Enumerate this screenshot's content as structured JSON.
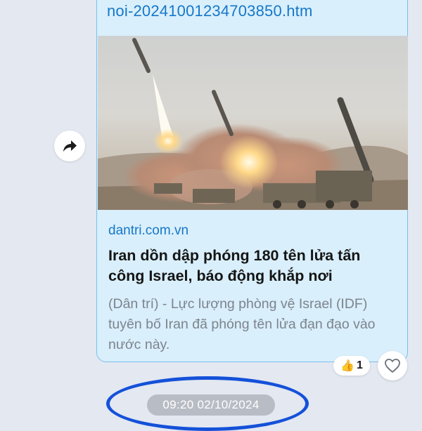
{
  "message": {
    "link_url_fragment": "noi-20241001234703850.htm",
    "preview": {
      "image_name": "missile-launch-photo",
      "domain": "dantri.com.vn",
      "title": "Iran dồn dập phóng 180 tên lửa tấn công Israel, báo động khắp nơi",
      "description": "(Dân trí) - Lực lượng phòng vệ Israel (IDF) tuyên bố Iran đã phóng tên lửa đạn đạo vào nước này."
    },
    "reaction": {
      "emoji": "👍",
      "count": "1"
    }
  },
  "timestamp": "09:20 02/10/2024",
  "icons": {
    "share": "share-arrow-icon",
    "heart": "heart-outline-icon"
  },
  "colors": {
    "bubble_bg": "#d9effb",
    "bubble_border": "#77c0ee",
    "link": "#1677c9",
    "highlight": "#1451d9"
  }
}
